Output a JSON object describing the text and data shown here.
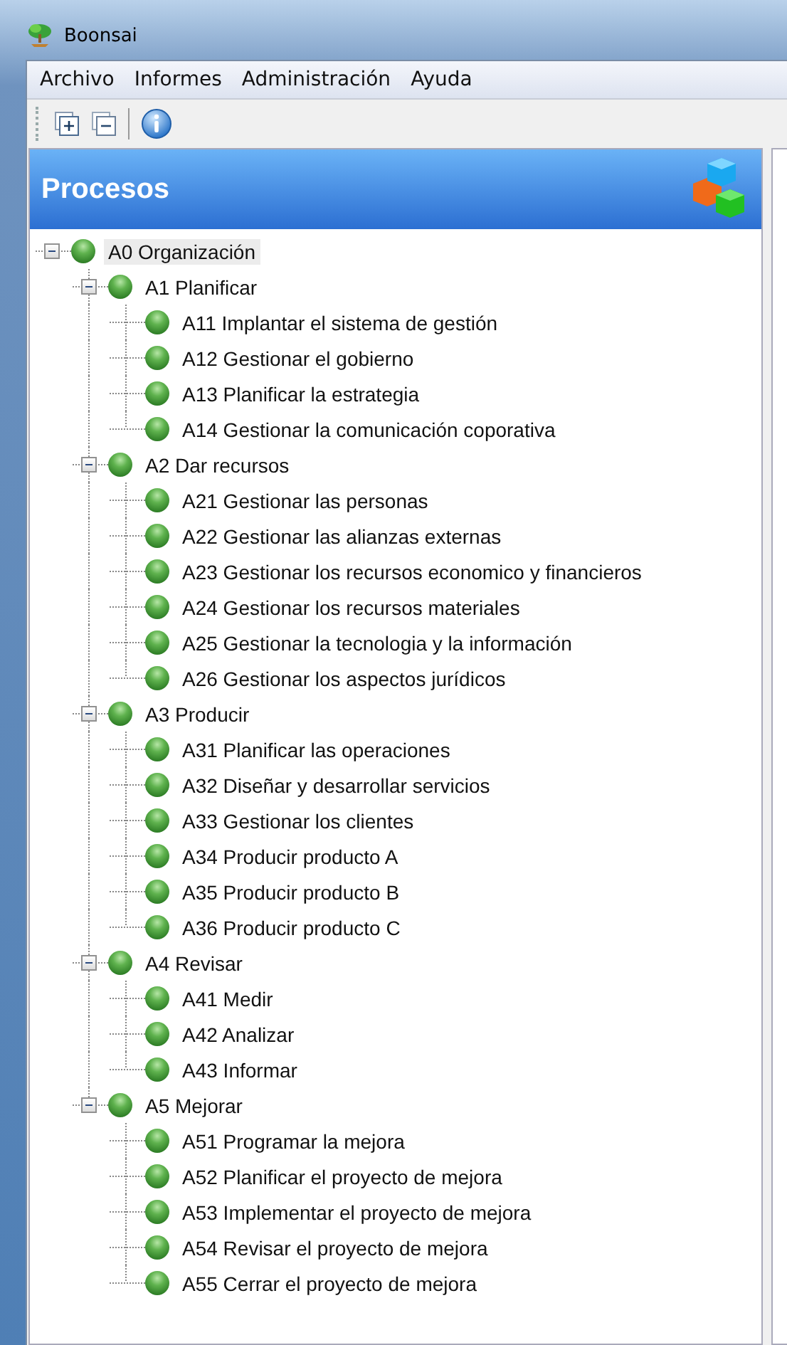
{
  "window": {
    "title": "Boonsai"
  },
  "menu": [
    "Archivo",
    "Informes",
    "Administración",
    "Ayuda"
  ],
  "panel": {
    "title": "Procesos"
  },
  "tree": [
    {
      "label": "A0 Organización",
      "selected": true,
      "expanded": true,
      "children": [
        {
          "label": "A1 Planificar",
          "selected": false,
          "expanded": true,
          "children": [
            {
              "label": "A11 Implantar el sistema de gestión",
              "selected": false
            },
            {
              "label": "A12 Gestionar el gobierno",
              "selected": false
            },
            {
              "label": "A13 Planificar la estrategia",
              "selected": false
            },
            {
              "label": "A14 Gestionar la comunicación coporativa",
              "selected": false
            }
          ]
        },
        {
          "label": "A2 Dar recursos",
          "selected": false,
          "expanded": true,
          "children": [
            {
              "label": "A21 Gestionar las personas",
              "selected": false
            },
            {
              "label": "A22 Gestionar las alianzas externas",
              "selected": false
            },
            {
              "label": "A23 Gestionar los recursos economico y financieros",
              "selected": false
            },
            {
              "label": "A24 Gestionar los recursos materiales",
              "selected": false
            },
            {
              "label": "A25 Gestionar la tecnologia y la información",
              "selected": false
            },
            {
              "label": "A26 Gestionar los aspectos jurídicos",
              "selected": false
            }
          ]
        },
        {
          "label": "A3 Producir",
          "selected": false,
          "expanded": true,
          "children": [
            {
              "label": "A31 Planificar las operaciones",
              "selected": false
            },
            {
              "label": "A32 Diseñar y desarrollar servicios",
              "selected": false
            },
            {
              "label": "A33 Gestionar los clientes",
              "selected": false
            },
            {
              "label": "A34 Producir producto A",
              "selected": false
            },
            {
              "label": "A35 Producir producto B",
              "selected": false
            },
            {
              "label": "A36 Producir producto C",
              "selected": false
            }
          ]
        },
        {
          "label": "A4 Revisar",
          "selected": false,
          "expanded": true,
          "children": [
            {
              "label": "A41 Medir",
              "selected": false
            },
            {
              "label": "A42 Analizar",
              "selected": false
            },
            {
              "label": "A43 Informar",
              "selected": false
            }
          ]
        },
        {
          "label": "A5 Mejorar",
          "selected": false,
          "expanded": true,
          "children": [
            {
              "label": "A51 Programar la mejora",
              "selected": false
            },
            {
              "label": "A52 Planificar el proyecto de mejora",
              "selected": false
            },
            {
              "label": "A53 Implementar el proyecto de mejora",
              "selected": false
            },
            {
              "label": "A54 Revisar el proyecto de mejora",
              "selected": false
            },
            {
              "label": "A55 Cerrar el proyecto de mejora",
              "selected": false
            }
          ]
        }
      ]
    }
  ]
}
